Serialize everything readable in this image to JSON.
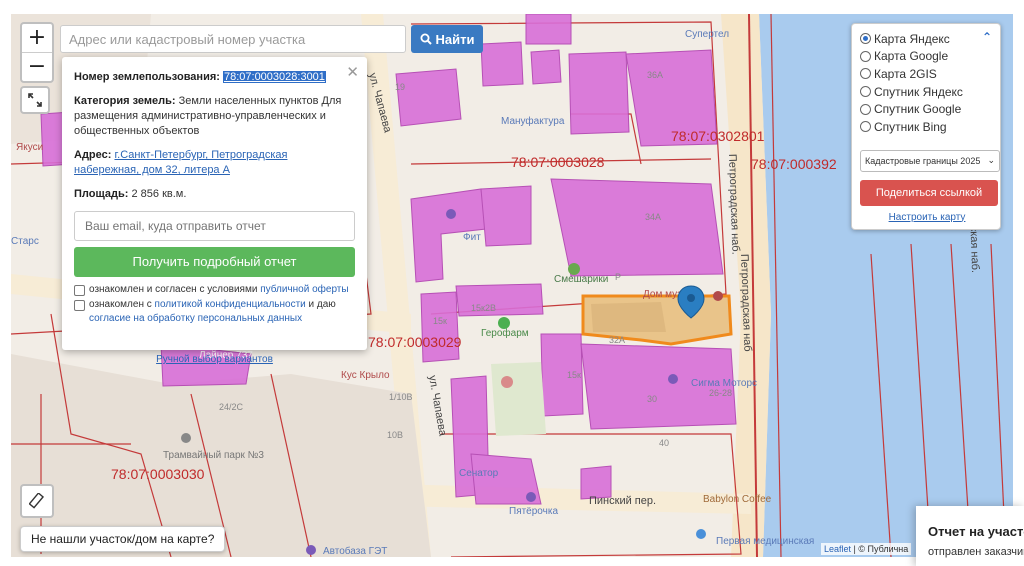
{
  "map": {
    "cadastral_labels": [
      "78:07:0302801",
      "78:07:0003028",
      "78:07:000392",
      "78:07:0003029",
      "78:07:0003030"
    ],
    "street_labels": [
      "ул. Чапаева",
      "Петроградская наб.",
      "Пироговская наб.",
      "Петроградская наб",
      "ул. Чапаева",
      "Пинский пер."
    ],
    "poi_labels": [
      "Мануфактура",
      "Фит",
      "Смешарики",
      "Герофарм",
      "Дом музыки",
      "Сигма Моторс",
      "Сенатор",
      "Пятёрочка",
      "Babylon Coffee",
      "Супертел",
      "Якуси",
      "Кус Крыло",
      "Трамвайный парк №3",
      "Автобаза ГЭТ",
      "Первая медицинская",
      "Лайнер 737",
      "Старс"
    ],
    "building_numbers": [
      "36А",
      "34А",
      "19",
      "15к2В",
      "15к",
      "32А",
      "15к",
      "30",
      "26-28",
      "24/2С",
      "1/10В",
      "10В",
      "40",
      "Р"
    ],
    "colors": {
      "parcel_fill": "#d86fd8",
      "parcel_border": "#c43a3a",
      "selected_parcel": "#f08a1c",
      "marker": "#2a7ec2",
      "river": "#a9cbee"
    }
  },
  "controls": {
    "zoom_in": "+",
    "zoom_out": "−",
    "fullscreen_icon": "expand-icon",
    "ruler_icon": "ruler-icon"
  },
  "search": {
    "placeholder": "Адрес или кадастровый номер участка",
    "button_label": "Найти"
  },
  "popup": {
    "land_use_label": "Номер землепользования:",
    "land_use_value": "78:07:0003028:3001",
    "category_label": "Категория земель:",
    "category_value": "Земли населенных пунктов Для размещения административно-управленческих и общественных объектов",
    "address_label": "Адрес:",
    "address_value": "г.Санкт-Петербург, Петроградская набережная, дом 32, литера А",
    "area_label": "Площадь:",
    "area_value": "2 856 кв.м.",
    "email_placeholder": "Ваш email, куда отправить отчет",
    "report_button": "Получить подробный отчет",
    "agree1_text": "ознакомлен и согласен с условиями",
    "agree1_link": "публичной оферты",
    "agree2_text": "ознакомлен с",
    "agree2_link": "политикой конфиденциальности",
    "agree2_tail": "и даю",
    "agree2_link2": "согласие на обработку персональных данных",
    "manual_link": "Ручной выбор вариантов",
    "close": "✕"
  },
  "layers": {
    "items": [
      {
        "label": "Карта Яндекс",
        "selected": true
      },
      {
        "label": "Карта Google",
        "selected": false
      },
      {
        "label": "Карта 2GIS",
        "selected": false
      },
      {
        "label": "Спутник Яндекс",
        "selected": false
      },
      {
        "label": "Спутник Google",
        "selected": false
      },
      {
        "label": "Спутник Bing",
        "selected": false
      }
    ],
    "select_value": "Кадастровые границы 2025",
    "share_button": "Поделиться ссылкой",
    "adjust_link": "Настроить карту"
  },
  "not_found": "Не нашли участок/дом на карте?",
  "attribution": {
    "leaflet": "Leaflet",
    "rest": "| © Публична"
  },
  "toast": {
    "title": "Отчет на участо",
    "subtitle": "отправлен заказчик"
  }
}
